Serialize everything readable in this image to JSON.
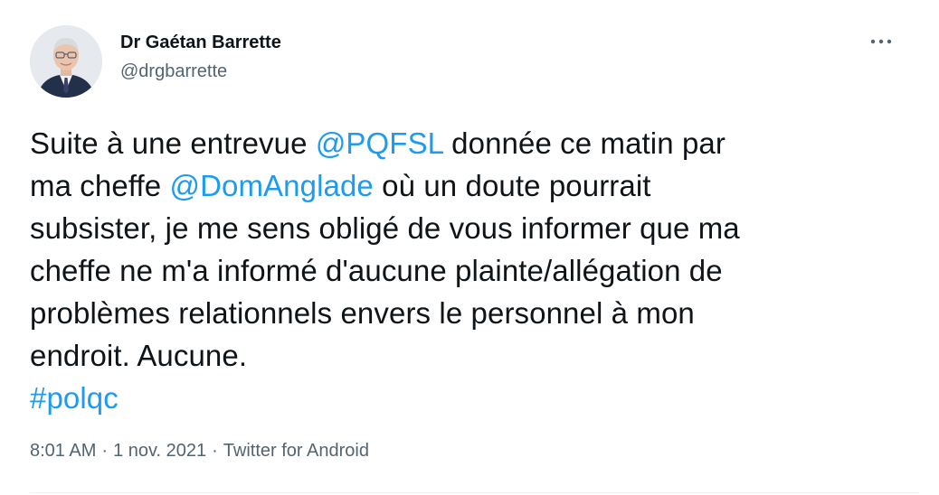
{
  "author": {
    "name": "Dr Gaétan Barrette",
    "handle": "@drgbarrette"
  },
  "tweet": {
    "line1": {
      "a": "Suite à une entrevue ",
      "mention": "@PQFSL",
      "b": " donnée ce matin par"
    },
    "line2": {
      "a": "ma cheffe ",
      "mention": "@DomAnglade",
      "b": " où un doute pourrait"
    },
    "line3": "subsister, je me sens obligé de vous informer que ma",
    "line4": "cheffe ne m'a informé d'aucune plainte/allégation de",
    "line5": "problèmes relationnels envers le personnel à mon",
    "line6": "endroit. Aucune.",
    "hashtag": "#polqc"
  },
  "meta": {
    "time": "8:01 AM",
    "date": "1 nov. 2021",
    "source": "Twitter for Android",
    "separator": "·"
  },
  "icons": {
    "more": "more-options-icon"
  },
  "colors": {
    "link": "#1d9bf0",
    "secondary": "#536471",
    "text": "#0f1419"
  }
}
